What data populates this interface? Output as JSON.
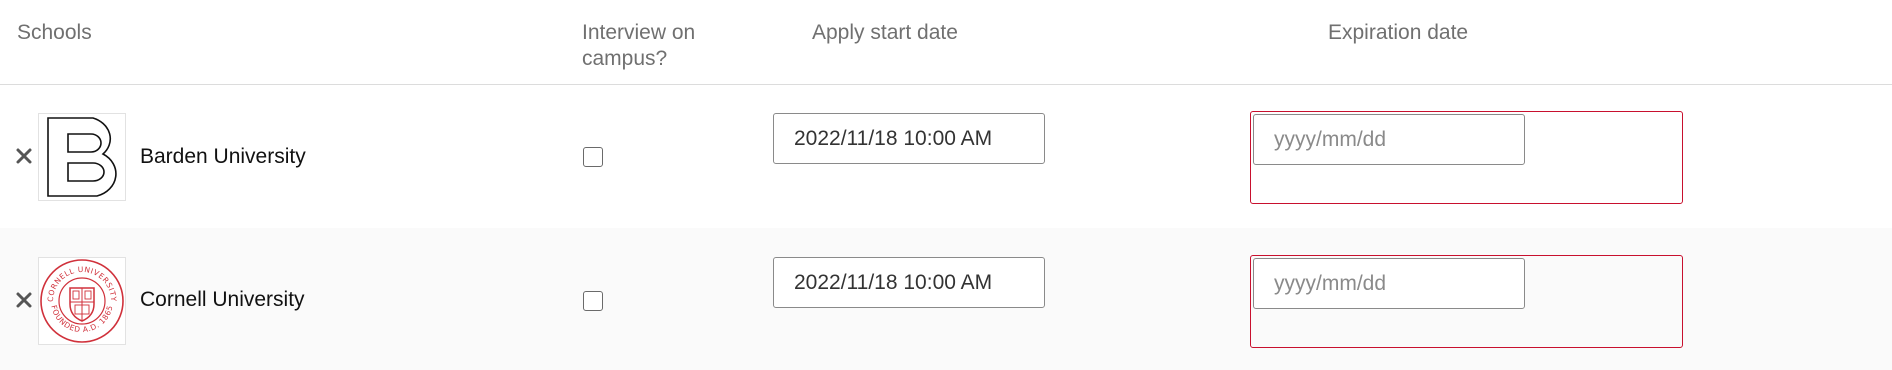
{
  "header": {
    "schools": "Schools",
    "interview": "Interview on campus?",
    "apply_start": "Apply start date",
    "expiration": "Expiration date"
  },
  "rows": [
    {
      "school_name": "Barden University",
      "logo_icon": "barden-b-logo",
      "remove_icon": "close-icon",
      "interview_checked": false,
      "apply_start_value": "2022/11/18 10:00 AM",
      "expiration_placeholder": "yyyy/mm/dd"
    },
    {
      "school_name": "Cornell University",
      "logo_icon": "cornell-seal-logo",
      "remove_icon": "close-icon",
      "interview_checked": false,
      "apply_start_value": "2022/11/18 10:00 AM",
      "expiration_placeholder": "yyyy/mm/dd",
      "logo_text": [
        "CORNELL UNIVERSITY",
        "FOUNDED A.D. 1865"
      ]
    }
  ],
  "colors": {
    "error_border": "#c8102e",
    "cornell_red": "#d0313b",
    "header_text": "#707070"
  }
}
